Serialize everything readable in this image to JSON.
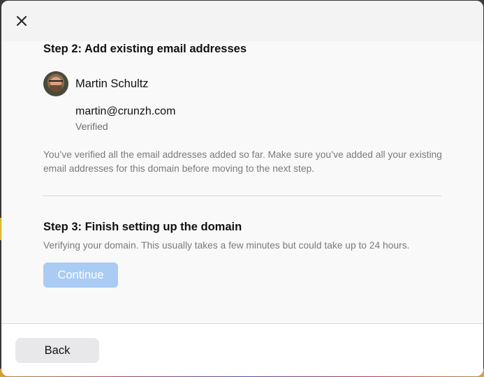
{
  "dialog": {
    "close_icon": "close-icon",
    "step2": {
      "title": "Step 2: Add existing email addresses",
      "user": {
        "name": "Martin Schultz"
      },
      "email": "martin@crunzh.com",
      "email_status": "Verified",
      "note": "You’ve verified all the email addresses added so far. Make sure you’ve added all your existing email addresses for this domain before moving to the next step."
    },
    "step3": {
      "title": "Step 3: Finish setting up the domain",
      "description": "Verifying your domain. This usually takes a few minutes but could take up to 24 hours.",
      "continue_label": "Continue"
    },
    "footer": {
      "back_label": "Back"
    }
  },
  "colors": {
    "accent_disabled": "#a9cbf4",
    "secondary_text": "#7a7a7a"
  }
}
